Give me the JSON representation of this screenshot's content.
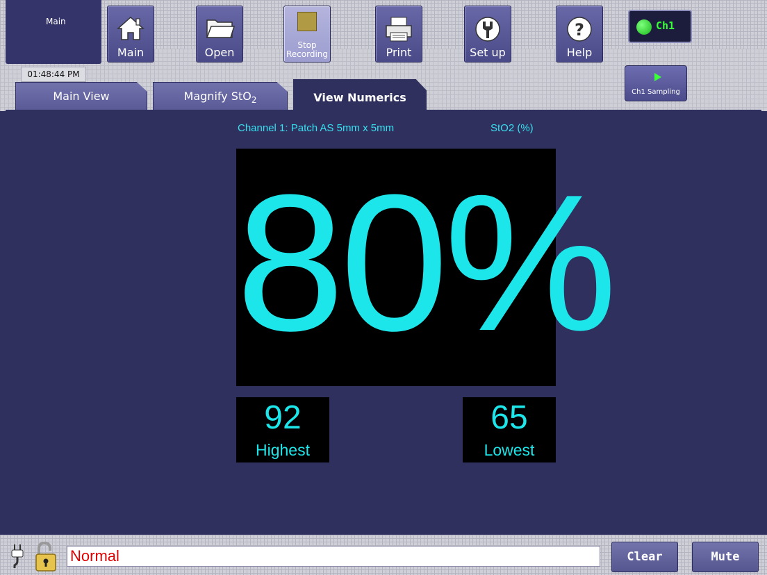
{
  "header": {
    "context_label": "Main",
    "clock": "01:48:44 PM",
    "toolbar": [
      {
        "id": "main",
        "label": "Main",
        "icon": "home-icon"
      },
      {
        "id": "open",
        "label": "Open",
        "icon": "folder-icon"
      },
      {
        "id": "stop",
        "label": "Stop Recording",
        "line1": "Stop",
        "line2": "Recording",
        "icon": "stop-icon"
      },
      {
        "id": "print",
        "label": "Print",
        "icon": "printer-icon"
      },
      {
        "id": "setup",
        "label": "Set up",
        "icon": "wrench-icon"
      },
      {
        "id": "help",
        "label": "Help",
        "icon": "help-icon"
      }
    ],
    "channel_indicator": {
      "label": "Ch1",
      "status_color": "#2fd12f"
    },
    "sampling_button": {
      "label": "Ch1 Sampling",
      "icon": "play-icon"
    }
  },
  "tabs": [
    {
      "label": "Main View",
      "selected": false
    },
    {
      "label": "Magnify StO",
      "subscript": "2",
      "selected": false
    },
    {
      "label": "View Numerics",
      "selected": true
    }
  ],
  "numerics": {
    "channel_title": "Channel 1: Patch AS 5mm x 5mm",
    "measure_unit": "StO2 (%)",
    "current_value": "80%",
    "highest": {
      "value": "92",
      "label": "Highest"
    },
    "lowest": {
      "value": "65",
      "label": "Lowest"
    },
    "value_color": "#1de6ea"
  },
  "footer": {
    "status_text": "Normal",
    "status_color": "#e00000",
    "clear_label": "Clear",
    "mute_label": "Mute",
    "icons": [
      "power-plug-icon",
      "unlock-icon"
    ]
  }
}
